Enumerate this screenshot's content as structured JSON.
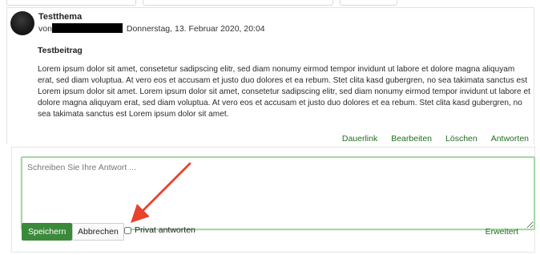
{
  "post": {
    "subject": "Testthema",
    "by_prefix": "von",
    "date": "Donnerstag, 13. Februar 2020, 20:04",
    "title": "Testbeitrag",
    "body": "Lorem ipsum dolor sit amet, consetetur sadipscing elitr, sed diam nonumy eirmod tempor invidunt ut labore et dolore magna aliquyam erat, sed diam voluptua. At vero eos et accusam et justo duo dolores et ea rebum. Stet clita kasd gubergren, no sea takimata sanctus est Lorem ipsum dolor sit amet. Lorem ipsum dolor sit amet, consetetur sadipscing elitr, sed diam nonumy eirmod tempor invidunt ut labore et dolore magna aliquyam erat, sed diam voluptua. At vero eos et accusam et justo duo dolores et ea rebum. Stet clita kasd gubergren, no sea takimata sanctus est Lorem ipsum dolor sit amet.",
    "links": {
      "permalink": "Dauerlink",
      "edit": "Bearbeiten",
      "delete": "Löschen",
      "reply": "Antworten"
    }
  },
  "reply_form": {
    "placeholder": "Schreiben Sie Ihre Antwort ...",
    "value": "",
    "save_label": "Speichern",
    "cancel_label": "Abbrechen",
    "private_label": "Privat antworten",
    "private_checked": false,
    "advanced_label": "Erweitert"
  },
  "colors": {
    "link_green": "#1f6e1f",
    "save_button": "#3b8a3b",
    "textarea_focus": "#a9d8a9",
    "annotation_red": "#e8412c"
  },
  "icons": {
    "avatar": "user-avatar",
    "annotation": "red-arrow-annotation",
    "resize": "resize-grip-icon"
  }
}
